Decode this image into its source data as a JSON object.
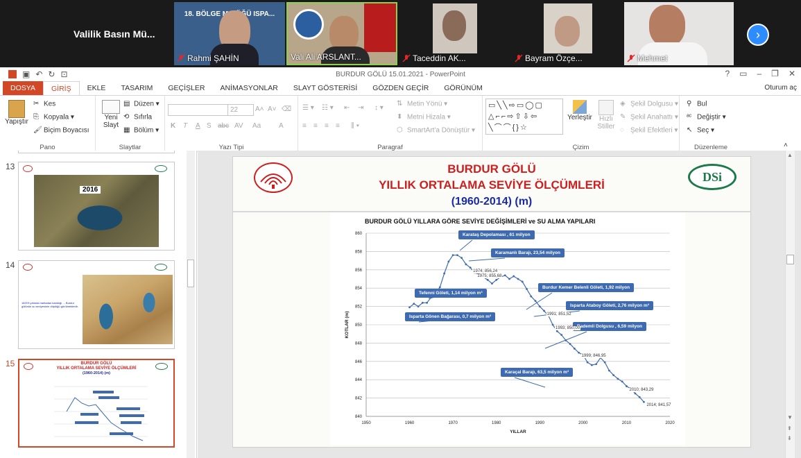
{
  "zoom": {
    "room_label": "Valilik Basın Mü...",
    "participants": [
      {
        "name": "Rahmi ŞAHİN",
        "muted": true,
        "bg_text": "18. BÖLGE M... ÜĞÜ ISPA..."
      },
      {
        "name": "Vali Ali ARSLANT...",
        "muted": false
      },
      {
        "name": "Taceddin AK...",
        "muted": true
      },
      {
        "name": "Bayram Özçe...",
        "muted": true
      },
      {
        "name": "Mehmet",
        "muted": true
      }
    ],
    "next_icon": "chevron-right-icon"
  },
  "ppt": {
    "window_title": "BURDUR GÖLÜ 15.01.2021 - PowerPoint",
    "tabs": [
      "DOSYA",
      "GİRİŞ",
      "EKLE",
      "TASARIM",
      "GEÇİŞLER",
      "ANİMASYONLAR",
      "SLAYT GÖSTERİSİ",
      "GÖZDEN GEÇİR",
      "GÖRÜNÜM"
    ],
    "active_tab": "GİRİŞ",
    "signin": "Oturum aç",
    "ribbon": {
      "pano": {
        "label": "Pano",
        "paste": "Yapıştır",
        "cut": "Kes",
        "copy": "Kopyala",
        "format_painter": "Biçim Boyacısı"
      },
      "slaytlar": {
        "label": "Slaytlar",
        "new_slide_1": "Yeni",
        "new_slide_2": "Slayt",
        "layout": "Düzen",
        "reset": "Sıfırla",
        "section": "Bölüm"
      },
      "yazi_tipi": {
        "label": "Yazı Tipi",
        "size": "22",
        "buttons": [
          "K",
          "T",
          "A",
          "S",
          "abc",
          "AV",
          "Aa",
          "A"
        ]
      },
      "paragraf": {
        "label": "Paragraf",
        "text_direction": "Metin Yönü",
        "align_text": "Metni Hizala",
        "smartart": "SmartArt'a Dönüştür"
      },
      "cizim": {
        "label": "Çizim",
        "arrange_1": "Yerleştir",
        "quick_styles_1": "Hızlı",
        "quick_styles_2": "Stiller",
        "fill": "Şekil Dolgusu",
        "outline": "Şekil Anahattı",
        "effects": "Şekil Efektleri"
      },
      "duzenleme": {
        "label": "Düzenleme",
        "find": "Bul",
        "replace": "Değiştir",
        "select": "Seç"
      }
    },
    "thumbnails": [
      {
        "number": "13",
        "year_label": "2016"
      },
      {
        "number": "14",
        "caption": "1820'li yıllarda haritadan katıldığı ... Burdur gölünün su seviyesinin düştüğü görülmektedir."
      },
      {
        "number": "15",
        "title_1": "BURDUR GÖLÜ",
        "title_2": "YILLIK ORTALAMA SEVİYE ÖLÇÜMLERİ",
        "title_3": "(1960-2014) (m)"
      }
    ],
    "slide": {
      "title_1": "BURDUR GÖLÜ",
      "title_2": "YILLIK ORTALAMA SEVİYE ÖLÇÜMLERİ",
      "title_3": "(1960-2014) (m)",
      "logo_right_text": "DSi",
      "accent_red": "#cc1f1f",
      "accent_blue": "#1a2aa8",
      "accent_green": "#1c7a4a"
    }
  },
  "chart_data": {
    "type": "line",
    "title": "BURDUR GÖLÜ YILLARA GÖRE SEVİYE DEĞİŞİMLERİ  ve SU ALMA YAPILARI",
    "xlabel": "YILLAR",
    "ylabel": "KOTLAR (m)",
    "xlim": [
      1950,
      2020
    ],
    "ylim": [
      840,
      860
    ],
    "xticks": [
      1950,
      1960,
      1970,
      1980,
      1990,
      2000,
      2010,
      2020
    ],
    "yticks": [
      840,
      842,
      844,
      846,
      848,
      850,
      852,
      854,
      856,
      858,
      860
    ],
    "grid": true,
    "series": [
      {
        "color": "#3e6ab0",
        "x": [
          1960,
          1961,
          1962,
          1963,
          1964,
          1965,
          1966,
          1967,
          1968,
          1969,
          1970,
          1971,
          1972,
          1973,
          1974,
          1975,
          1976,
          1977,
          1978,
          1979,
          1980,
          1981,
          1982,
          1983,
          1984,
          1985,
          1986,
          1987,
          1988,
          1989,
          1990,
          1991,
          1992,
          1993,
          1994,
          1995,
          1996,
          1997,
          1998,
          1999,
          2000,
          2001,
          2002,
          2003,
          2004,
          2005,
          2006,
          2007,
          2008,
          2009,
          2010,
          2011,
          2012,
          2013,
          2014
        ],
        "y": [
          851.9,
          852.3,
          852.0,
          852.4,
          852.4,
          853.0,
          853.4,
          854.1,
          855.6,
          856.9,
          857.6,
          857.6,
          857.3,
          856.6,
          856.24,
          855.68,
          855.5,
          855.2,
          854.9,
          854.5,
          854.9,
          855.2,
          855.4,
          855.0,
          855.3,
          855.0,
          854.7,
          853.9,
          853.1,
          852.6,
          852.0,
          851.52,
          851.0,
          850.0,
          849.3,
          848.9,
          848.3,
          847.9,
          847.4,
          846.95,
          846.7,
          845.9,
          845.6,
          845.7,
          846.4,
          845.9,
          845.0,
          844.5,
          844.1,
          843.8,
          843.29,
          843.0,
          842.5,
          842.1,
          841.57
        ]
      }
    ],
    "data_labels": [
      {
        "text": "1974; 856,24",
        "x": 1974,
        "y": 856.24
      },
      {
        "text": "1975; 855,68",
        "x": 1975,
        "y": 855.68
      },
      {
        "text": "1991; 851,52",
        "x": 1991,
        "y": 851.52
      },
      {
        "text": "1993; 850,00",
        "x": 1993,
        "y": 850.0
      },
      {
        "text": "1999; 846,95",
        "x": 1999,
        "y": 846.95
      },
      {
        "text": "2010; 843,29",
        "x": 2010,
        "y": 843.29
      },
      {
        "text": "2014; 841,57",
        "x": 2014,
        "y": 841.57
      }
    ],
    "annotations": [
      "Karataş Depolaması , 61 milyon",
      "Karamanlı Barajı, 23,54 milyon",
      "Burdur Kemer Belenli Göleti, 1,92 milyon",
      "Tefenni Göleti,  1,14 milyon m³",
      "Isparta Ataboy Göleti, 2,76 milyon m³",
      "Isparta Gönen Bağarası, 0,7 milyon m³",
      "Bademli  Dolgusu , 6,59 milyon",
      "Karaçal Barajı, 63,5 milyon m³"
    ]
  }
}
